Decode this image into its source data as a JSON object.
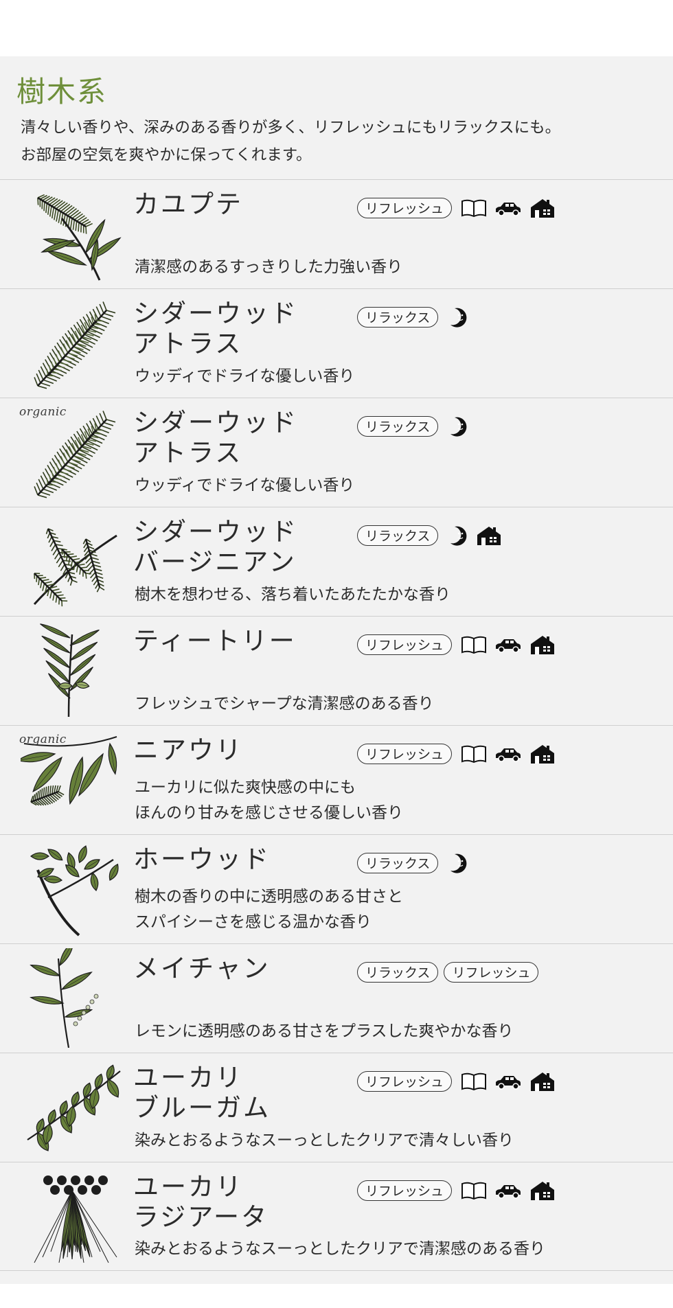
{
  "section": {
    "title": "樹木系",
    "intro": [
      "清々しい香りや、深みのある香りが多く、リフレッシュにもリラックスにも。",
      "お部屋の空気を爽やかに保ってくれます。"
    ]
  },
  "colors": {
    "accent": "#6e8f3a",
    "panel": "#f2f2f2",
    "leaf": "#67803a"
  },
  "items": [
    {
      "name": [
        "カユプテ"
      ],
      "organic": "",
      "tags": [
        "リフレッシュ"
      ],
      "icons": [
        "book-icon",
        "car-icon",
        "house-icon"
      ],
      "desc": [
        "清潔感のあるすっきりした力強い香り"
      ],
      "plant": "bottlebrush"
    },
    {
      "name": [
        "シダーウッド",
        "アトラス"
      ],
      "organic": "",
      "tags": [
        "リラックス"
      ],
      "icons": [
        "moon-icon"
      ],
      "desc": [
        "ウッディでドライな優しい香り"
      ],
      "plant": "cedar"
    },
    {
      "name": [
        "シダーウッド",
        "アトラス"
      ],
      "organic": "organic",
      "tags": [
        "リラックス"
      ],
      "icons": [
        "moon-icon"
      ],
      "desc": [
        "ウッディでドライな優しい香り"
      ],
      "plant": "cedar"
    },
    {
      "name": [
        "シダーウッド",
        "バージニアン"
      ],
      "organic": "",
      "tags": [
        "リラックス"
      ],
      "icons": [
        "moon-icon",
        "house-icon"
      ],
      "desc": [
        "樹木を想わせる、落ち着いたあたたかな香り"
      ],
      "plant": "juniper"
    },
    {
      "name": [
        "ティートリー"
      ],
      "organic": "",
      "tags": [
        "リフレッシュ"
      ],
      "icons": [
        "book-icon",
        "car-icon",
        "house-icon"
      ],
      "desc": [
        "フレッシュでシャープな清潔感のある香り"
      ],
      "plant": "teatree"
    },
    {
      "name": [
        "ニアウリ"
      ],
      "organic": "organic",
      "tags": [
        "リフレッシュ"
      ],
      "icons": [
        "book-icon",
        "car-icon",
        "house-icon"
      ],
      "desc": [
        "ユーカリに似た爽快感の中にも",
        "ほんのり甘みを感じさせる優しい香り"
      ],
      "plant": "niaouli"
    },
    {
      "name": [
        "ホーウッド"
      ],
      "organic": "",
      "tags": [
        "リラックス"
      ],
      "icons": [
        "moon-icon"
      ],
      "desc": [
        "樹木の香りの中に透明感のある甘さと",
        "スパイシーさを感じる温かな香り"
      ],
      "plant": "howood"
    },
    {
      "name": [
        "メイチャン"
      ],
      "organic": "",
      "tags": [
        "リラックス",
        "リフレッシュ"
      ],
      "icons": [],
      "desc": [
        "レモンに透明感のある甘さをプラスした爽やかな香り"
      ],
      "plant": "maychang"
    },
    {
      "name": [
        "ユーカリ",
        "ブルーガム"
      ],
      "organic": "",
      "tags": [
        "リフレッシュ"
      ],
      "icons": [
        "book-icon",
        "car-icon",
        "house-icon"
      ],
      "desc": [
        "染みとおるようなスーっとしたクリアで清々しい香り"
      ],
      "plant": "eucalyptus"
    },
    {
      "name": [
        "ユーカリ",
        "ラジアータ"
      ],
      "organic": "",
      "tags": [
        "リフレッシュ"
      ],
      "icons": [
        "book-icon",
        "car-icon",
        "house-icon"
      ],
      "desc": [
        "染みとおるようなスーっとしたクリアで清潔感のある香り"
      ],
      "plant": "radiata"
    }
  ]
}
